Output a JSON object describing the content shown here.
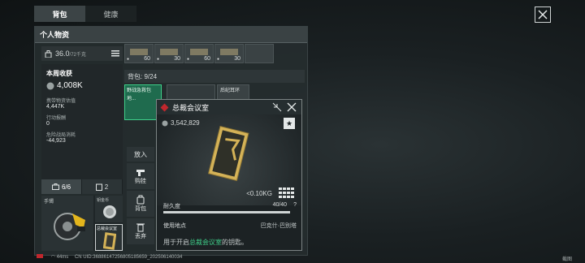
{
  "tabs": [
    {
      "label": "背包",
      "active": true
    },
    {
      "label": "健康",
      "active": false
    }
  ],
  "panel": {
    "title": "个人物资"
  },
  "capacity": {
    "value": "36.0",
    "max": "/72千克"
  },
  "weekly": {
    "title": "本周收获",
    "value": "4,008K",
    "carry_label": "携带物资估值",
    "carry_value": "4,447K",
    "action_label": "行动报酬",
    "action_value": "0",
    "loss_label": "危险战局消耗",
    "loss_value": "-44,923"
  },
  "team_tabs": [
    {
      "label": "6/6",
      "active": true
    },
    {
      "label": "2",
      "active": false
    }
  ],
  "gear": {
    "weapon_label": "手镯",
    "item_label": "钥金币",
    "key_label": "总裁会议室"
  },
  "top_slots": [
    {
      "count": "60"
    },
    {
      "count": "30"
    },
    {
      "count": "60"
    },
    {
      "count": "30"
    }
  ],
  "bag": {
    "label": "背包: 9/24",
    "item1_label": "野战急救包",
    "item1_sub": "地...",
    "item2_label": "后纪耳环"
  },
  "actions": [
    {
      "label": "放入",
      "icon": ""
    },
    {
      "label": "购挂",
      "icon": "gun-icon"
    },
    {
      "label": "背包",
      "icon": "backpack-icon"
    },
    {
      "label": "丢弃",
      "icon": "trash-icon"
    }
  ],
  "popup": {
    "title": "总裁会议室",
    "price": "3,542,829",
    "weight": "<0.10KG",
    "durability_label": "耐久度",
    "durability_value": "40/40",
    "durability_help": "?",
    "usage_label": "使用地点",
    "usage_value": "巴克什·巴别塔",
    "desc_prefix": "用于开启",
    "desc_highlight": "总裁会议室",
    "desc_suffix": "的钥匙。"
  },
  "status": {
    "ping": "44ms",
    "uid": "CN UID:36886147256805185659_202506140034",
    "corner": "截图"
  },
  "colors": {
    "accent_green": "#3fd08a",
    "rarity_red": "#c1272d",
    "key_gold": "#d4b257"
  }
}
